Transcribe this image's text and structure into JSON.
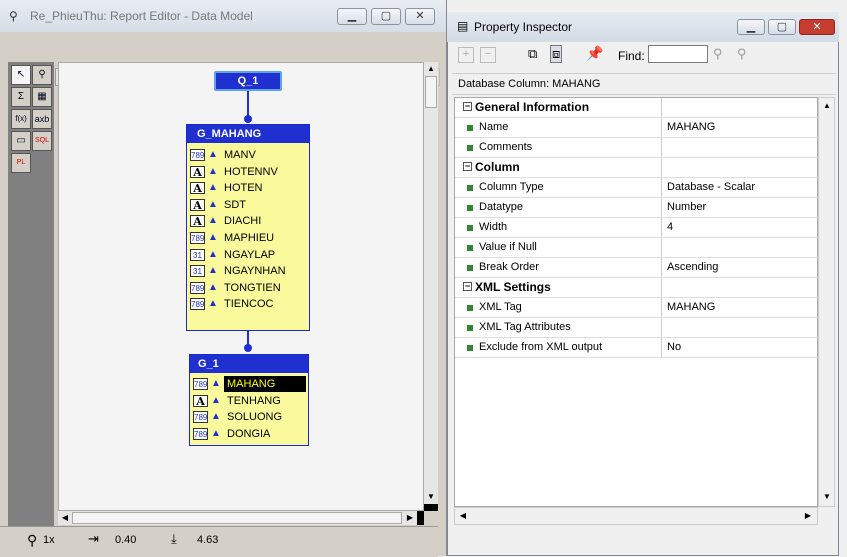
{
  "editor": {
    "title": "Re_PhieuThu: Report Editor - Data Model",
    "status": {
      "zoom": "1x",
      "x": "0.40",
      "y": "4.63"
    }
  },
  "icons": {
    "report_editor": "report-editor-icon",
    "minimize": "minimize-icon",
    "maximize": "maximize-icon",
    "close": "close-icon",
    "zoom": "magnifier-icon",
    "number_col": "number-column-icon",
    "text_col": "text-column-icon",
    "date_col": "date-column-icon",
    "pin": "pin-icon"
  },
  "toolbar_icons": [
    "data-model-icon",
    "report-icon",
    "paper-layout-icon",
    "paper-design-icon",
    "web-source-icon",
    "align-left-icon",
    "align-center-icon",
    "align-right-icon",
    "spread-icon",
    "group-icon",
    "ungroup-icon",
    "group-frame-icon",
    "expand-icon",
    "select-all-icon",
    "first-icon",
    "prev-icon"
  ],
  "palette": [
    {
      "name": "select-tool",
      "glyph": "↖"
    },
    {
      "name": "magnify-tool",
      "glyph": "🔍"
    },
    {
      "name": "summary-column-tool",
      "glyph": "Σ"
    },
    {
      "name": "data-link-tool",
      "glyph": "▦"
    },
    {
      "name": "formula-column-tool",
      "glyph": "f(x)"
    },
    {
      "name": "placeholder-column-tool",
      "glyph": "axb"
    },
    {
      "name": "cross-product-tool",
      "glyph": "▭"
    },
    {
      "name": "sql-query-tool",
      "glyph": "SQL"
    },
    {
      "name": "plsql-tool",
      "glyph": "PL"
    }
  ],
  "query": {
    "name": "Q_1"
  },
  "groups": [
    {
      "name": "G_MAHANG",
      "columns": [
        {
          "type": "num",
          "name": "MANV"
        },
        {
          "type": "txt",
          "name": "HOTENNV"
        },
        {
          "type": "txt",
          "name": "HOTEN"
        },
        {
          "type": "txt",
          "name": "SDT"
        },
        {
          "type": "txt",
          "name": "DIACHI"
        },
        {
          "type": "num",
          "name": "MAPHIEU"
        },
        {
          "type": "date",
          "name": "NGAYLAP"
        },
        {
          "type": "date",
          "name": "NGAYNHAN"
        },
        {
          "type": "num",
          "name": "TONGTIEN"
        },
        {
          "type": "num",
          "name": "TIENCOC"
        }
      ]
    },
    {
      "name": "G_1",
      "columns": [
        {
          "type": "num",
          "name": "MAHANG",
          "selected": true
        },
        {
          "type": "txt",
          "name": "TENHANG"
        },
        {
          "type": "num",
          "name": "SOLUONG"
        },
        {
          "type": "num",
          "name": "DONGIA"
        }
      ]
    }
  ],
  "column_type_glyphs": {
    "num": "789",
    "txt": "A",
    "date": "31"
  },
  "inspector": {
    "title": "Property Inspector",
    "find_label": "Find:",
    "find_value": "",
    "header": "Database Column: MAHANG",
    "rows": [
      {
        "cat": true,
        "label": "General Information",
        "value": ""
      },
      {
        "cat": false,
        "label": "Name",
        "value": "MAHANG"
      },
      {
        "cat": false,
        "label": "Comments",
        "value": ""
      },
      {
        "cat": true,
        "label": "Column",
        "value": ""
      },
      {
        "cat": false,
        "label": "Column Type",
        "value": "Database - Scalar"
      },
      {
        "cat": false,
        "label": "Datatype",
        "value": "Number"
      },
      {
        "cat": false,
        "label": "Width",
        "value": "4"
      },
      {
        "cat": false,
        "label": "Value if Null",
        "value": ""
      },
      {
        "cat": false,
        "label": "Break Order",
        "value": "Ascending"
      },
      {
        "cat": true,
        "label": "XML Settings",
        "value": ""
      },
      {
        "cat": false,
        "label": "XML Tag",
        "value": "MAHANG"
      },
      {
        "cat": false,
        "label": "XML Tag Attributes",
        "value": ""
      },
      {
        "cat": false,
        "label": "Exclude from XML output",
        "value": "No"
      }
    ]
  },
  "colors": {
    "group_header": "#1f2fd0",
    "group_body": "#fafa9c",
    "selection": "#000000"
  }
}
